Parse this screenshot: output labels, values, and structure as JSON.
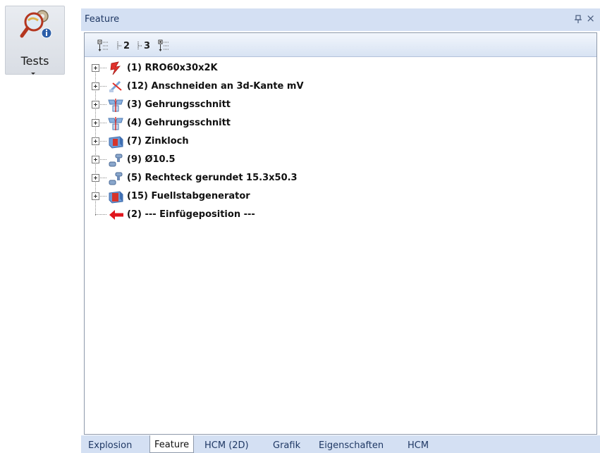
{
  "ribbon": {
    "tests_label": "Tests",
    "tests_icon": "magnifier-gear-info-icon"
  },
  "panel": {
    "title": "Feature",
    "pin_glyph": "ᵖ",
    "close_glyph": "×",
    "toolbar": [
      {
        "name": "collapse-all-icon",
        "num": ""
      },
      {
        "name": "level-2-icon",
        "num": "2"
      },
      {
        "name": "level-3-icon",
        "num": "3"
      },
      {
        "name": "expand-all-icon",
        "num": ""
      }
    ],
    "tree_items": [
      {
        "label": "(1) RRO60x30x2K",
        "icon": "profile-icon"
      },
      {
        "label": "(12) Anschneiden an 3d-Kante mV",
        "icon": "cut-edge-icon"
      },
      {
        "label": "(3) Gehrungsschnitt",
        "icon": "miter-cut-icon"
      },
      {
        "label": "(4) Gehrungsschnitt",
        "icon": "miter-cut-icon"
      },
      {
        "label": "(7) Zinkloch",
        "icon": "zinc-hole-icon"
      },
      {
        "label": "(9)  Ø10.5",
        "icon": "drill-hole-icon"
      },
      {
        "label": "(5)  Rechteck gerundet 15.3x50.3",
        "icon": "drill-hole-icon"
      },
      {
        "label": "(15) Fuellstabgenerator",
        "icon": "fill-bar-generator-icon"
      },
      {
        "label": "(2) --- Einfügeposition ---",
        "icon": "insert-position-arrow-icon"
      }
    ]
  },
  "tabs": [
    {
      "label": "Explosion",
      "active": false
    },
    {
      "label": "Feature",
      "active": true
    },
    {
      "label": "HCM (2D)",
      "active": false
    },
    {
      "label": "Grafik",
      "active": false
    },
    {
      "label": "Eigenschaften",
      "active": false
    },
    {
      "label": "HCM",
      "active": false
    }
  ],
  "colors": {
    "title_bar": "#d4e0f3",
    "insert_arrow": "#e0161d"
  }
}
